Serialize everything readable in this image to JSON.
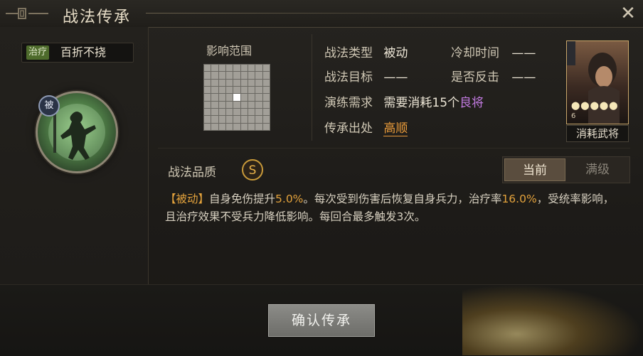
{
  "window": {
    "title": "战法传承",
    "close_label": "✕"
  },
  "skill": {
    "tag": "治疗",
    "name": "百折不挠",
    "passive_badge": "被"
  },
  "range": {
    "label": "影响范围"
  },
  "info": {
    "type_label": "战法类型",
    "type_value": "被动",
    "cooldown_label": "冷却时间",
    "cooldown_value": "——",
    "target_label": "战法目标",
    "target_value": "——",
    "counter_label": "是否反击",
    "counter_value": "——",
    "req_label": "演练需求",
    "req_prefix": "需要消耗",
    "req_count": "15",
    "req_unit": "个",
    "req_quality": "良将",
    "source_label": "传承出处",
    "source_value": "高顺"
  },
  "general_card": {
    "cost_label": "消耗武将",
    "level_text": "6"
  },
  "quality": {
    "label": "战法品质",
    "grade": "S"
  },
  "tabs": [
    {
      "label": "当前"
    },
    {
      "label": "满级"
    }
  ],
  "description": {
    "tag": "【被动】",
    "part1": "自身免伤提升",
    "num1": "5.0%",
    "part2": "。每次受到伤害后恢复自身兵力，治疗率",
    "num2": "16.0%",
    "part3": "，受统率影响，且治疗效果不受兵力降低影响。每回合最多触发3次。"
  },
  "confirm_button": {
    "label": "确认传承"
  },
  "colors": {
    "accent": "#e3a23c",
    "purple": "#c27ae0",
    "heal_tag": "#4e6b2c"
  }
}
